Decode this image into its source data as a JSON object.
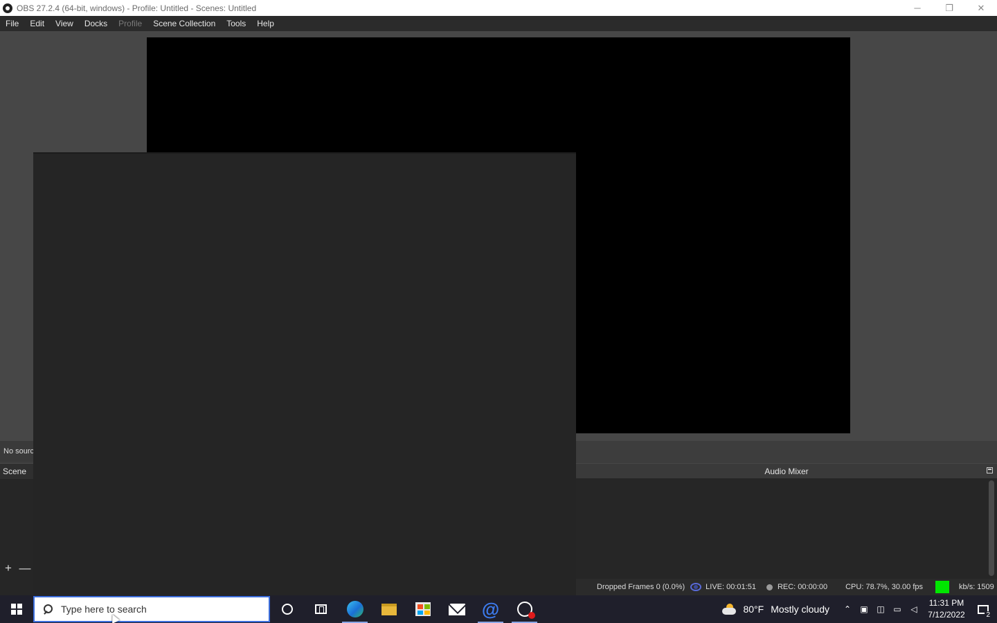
{
  "window": {
    "title": "OBS 27.2.4 (64-bit, windows) - Profile: Untitled - Scenes: Untitled",
    "minimize": "─",
    "restore": "❐",
    "close": "✕"
  },
  "menu": {
    "items": [
      "File",
      "Edit",
      "View",
      "Docks",
      "Profile",
      "Scene Collection",
      "Tools",
      "Help"
    ],
    "disabled": [
      "Profile"
    ]
  },
  "sources": {
    "empty_text": "No source"
  },
  "scenes": {
    "header": "Scene",
    "add_label": "+",
    "remove_label": "—"
  },
  "audio_mixer": {
    "title": "Audio Mixer"
  },
  "status": {
    "dropped_frames": "Dropped Frames 0 (0.0%)",
    "live": "LIVE: 00:01:51",
    "rec": "REC: 00:00:00",
    "cpu": "CPU: 78.7%, 30.00 fps",
    "kbs": "kb/s: 1509",
    "indicator_color": "#00e600"
  },
  "taskbar": {
    "search_placeholder": "Type here to search",
    "apps": [
      "cortana-icon",
      "task-view-icon",
      "edge-icon",
      "file-explorer-icon",
      "store-icon",
      "mail-icon",
      "at-app-icon",
      "obs-icon"
    ],
    "weather_temp": "80°F",
    "weather_desc": "Mostly cloudy",
    "time": "11:31 PM",
    "date": "7/12/2022",
    "notification_count": "2"
  },
  "colors": {
    "accent": "#3c6edc",
    "background": "#474747",
    "preview": "#000000"
  }
}
